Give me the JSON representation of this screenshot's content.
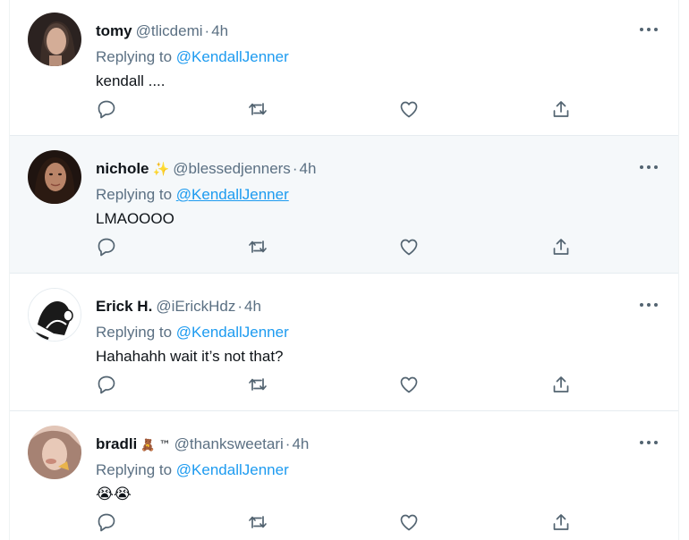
{
  "replying_label": "Replying to",
  "tweets": [
    {
      "name": "tomy",
      "badge": "",
      "handle": "@tlicdemi",
      "sep": "·",
      "time": "4h",
      "mention": "@KendallJenner",
      "text": "kendall ....",
      "avatar_colors": [
        "#3a2c2a",
        "#c7a08c"
      ],
      "icon_names": [
        "reply-icon",
        "retweet-icon",
        "like-icon",
        "share-icon",
        "more-icon"
      ]
    },
    {
      "name": "nichole",
      "badge": "✨",
      "handle": "@blessedjenners",
      "sep": "·",
      "time": "4h",
      "mention": "@KendallJenner",
      "text": "LMAOOOO",
      "avatar_colors": [
        "#2a1a14",
        "#b07a5e"
      ],
      "icon_names": [
        "reply-icon",
        "retweet-icon",
        "like-icon",
        "share-icon",
        "more-icon"
      ]
    },
    {
      "name": "Erick H.",
      "badge": "",
      "handle": "@iErickHdz",
      "sep": "·",
      "time": "4h",
      "mention": "@KendallJenner",
      "text": "Hahahahh wait it’s not that?",
      "avatar_colors": [
        "#ffffff",
        "#1a1a1a"
      ],
      "icon_names": [
        "reply-icon",
        "retweet-icon",
        "like-icon",
        "share-icon",
        "more-icon"
      ]
    },
    {
      "name": "bradli",
      "badge": "🧸 ™",
      "handle": "@thanksweetari",
      "sep": "·",
      "time": "4h",
      "mention": "@KendallJenner",
      "text": "😭😭",
      "avatar_colors": [
        "#d8b8a8",
        "#6a3e2e"
      ],
      "icon_names": [
        "reply-icon",
        "retweet-icon",
        "like-icon",
        "share-icon",
        "more-icon"
      ]
    }
  ],
  "colors": {
    "link": "#1d9bf0",
    "secondary_text": "#5b7083",
    "hover_bg": "#f5f8fa",
    "border": "#e6ecf0"
  }
}
